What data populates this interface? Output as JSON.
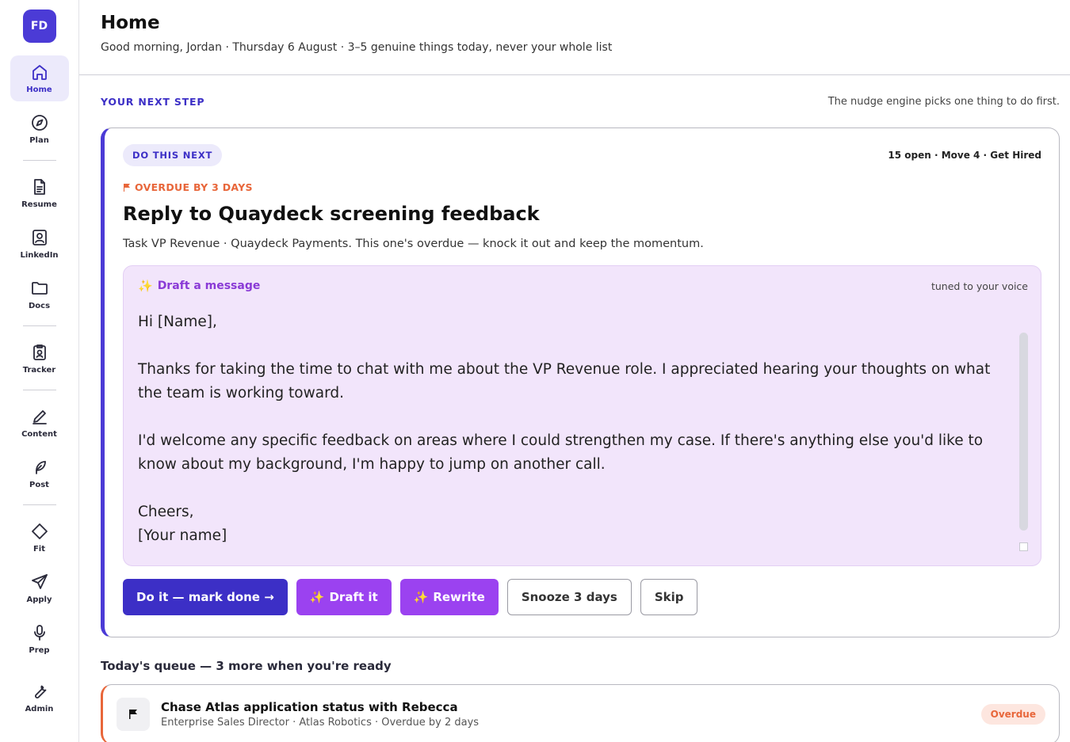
{
  "user": {
    "initials": "FD"
  },
  "sidebar": {
    "items": [
      {
        "label": "Home"
      },
      {
        "label": "Plan"
      },
      {
        "label": "Resume"
      },
      {
        "label": "LinkedIn"
      },
      {
        "label": "Docs"
      },
      {
        "label": "Tracker"
      },
      {
        "label": "Content"
      },
      {
        "label": "Post"
      },
      {
        "label": "Fit"
      },
      {
        "label": "Apply"
      },
      {
        "label": "Prep"
      },
      {
        "label": "Admin"
      }
    ]
  },
  "header": {
    "title": "Home",
    "subtitle": "Good morning, Jordan · Thursday 6 August · 3–5 genuine things today, never your whole list"
  },
  "next_step": {
    "section_label": "YOUR NEXT STEP",
    "section_note": "The nudge engine picks one thing to do first.",
    "badge": "DO THIS NEXT",
    "meta": "15 open · Move 4 · Get Hired",
    "overdue": "OVERDUE BY 3 DAYS",
    "title": "Reply to Quaydeck screening feedback",
    "description": "Task VP Revenue · Quaydeck Payments. This one's overdue — knock it out and keep the momentum.",
    "draft": {
      "title": "Draft a message",
      "note": "tuned to your voice",
      "lines": [
        "Hi [Name],",
        "",
        "Thanks for taking the time to chat with me about the VP Revenue role. I appreciated hearing your thoughts on what the team is working toward.",
        "",
        "I'd welcome any specific feedback on areas where I could strengthen my case. If there's anything else you'd like to know about my background, I'm happy to jump on another call.",
        "",
        "Cheers,",
        "[Your name]"
      ]
    },
    "actions": {
      "done": "Do it — mark done →",
      "draft": "Draft it",
      "rewrite": "Rewrite",
      "snooze": "Snooze 3 days",
      "skip": "Skip"
    }
  },
  "queue": {
    "title": "Today's queue — 3 more when you're ready",
    "items": [
      {
        "name": "Chase Atlas application status with Rebecca",
        "sub": "Enterprise Sales Director · Atlas Robotics · Overdue by 2 days",
        "status": "Overdue"
      }
    ]
  }
}
